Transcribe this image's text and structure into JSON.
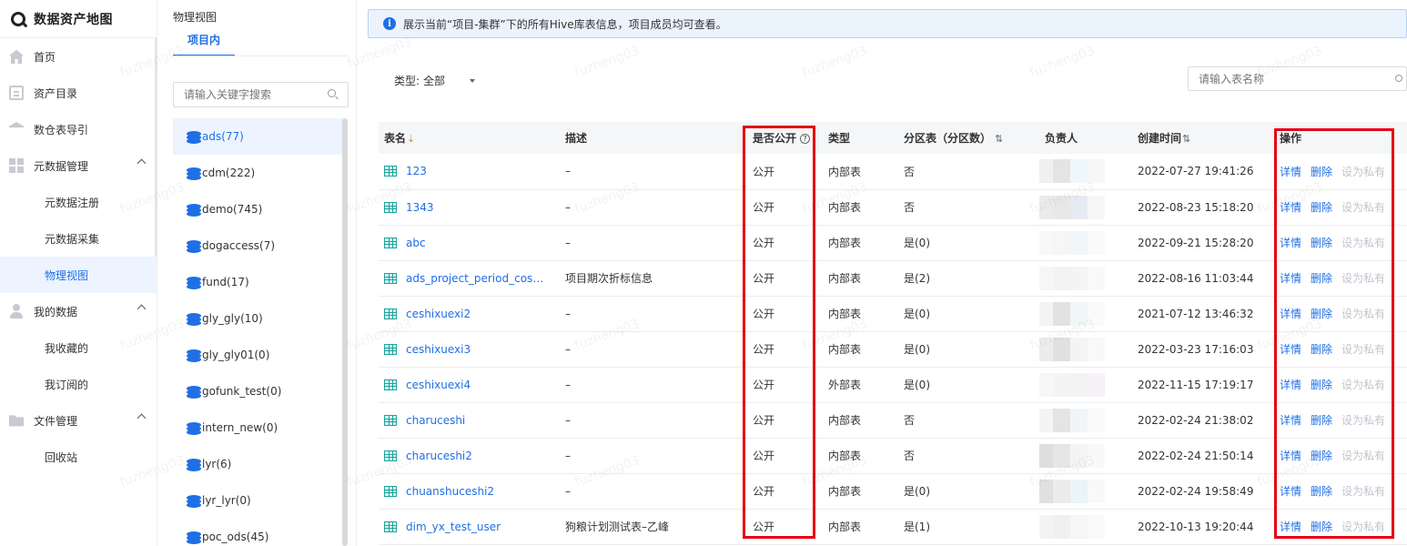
{
  "app": {
    "title": "数据资产地图"
  },
  "sidebar": {
    "items": [
      {
        "label": "首页"
      },
      {
        "label": "资产目录"
      },
      {
        "label": "数仓表导引"
      },
      {
        "label": "元数据管理"
      },
      {
        "label": "元数据注册"
      },
      {
        "label": "元数据采集"
      },
      {
        "label": "物理视图"
      },
      {
        "label": "我的数据"
      },
      {
        "label": "我收藏的"
      },
      {
        "label": "我订阅的"
      },
      {
        "label": "文件管理"
      },
      {
        "label": "回收站"
      }
    ]
  },
  "panel2": {
    "title": "物理视图",
    "tab": "项目内",
    "search_placeholder": "请输入关键字搜索",
    "databases": [
      "ads(77)",
      "cdm(222)",
      "demo(745)",
      "dogaccess(7)",
      "fund(17)",
      "gly_gly(10)",
      "gly_gly01(0)",
      "gofunk_test(0)",
      "intern_new(0)",
      "lyr(6)",
      "lyr_lyr(0)",
      "poc_ods(45)"
    ]
  },
  "notice": {
    "icon": "info-icon",
    "text": "展示当前“项目-集群”下的所有Hive库表信息，项目成员均可查看。"
  },
  "filter": {
    "label": "类型:",
    "value": "全部"
  },
  "table_search": {
    "placeholder": "请输入表名称"
  },
  "table": {
    "headers": {
      "name": "表名",
      "desc": "描述",
      "public": "是否公开",
      "type": "类型",
      "partition": "分区表（分区数）",
      "owner": "负责人",
      "created": "创建时间",
      "ops": "操作"
    },
    "sort_icon": "⇣",
    "question_mark": "?",
    "actions": {
      "detail": "详情",
      "delete": "删除",
      "set_private": "设为私有"
    },
    "rows": [
      {
        "name": "123",
        "desc": "–",
        "public": "公开",
        "type": "内部表",
        "partition": "否",
        "created": "2022-07-27 19:41:26"
      },
      {
        "name": "1343",
        "desc": "–",
        "public": "公开",
        "type": "内部表",
        "partition": "否",
        "created": "2022-08-23 15:18:20"
      },
      {
        "name": "abc",
        "desc": "–",
        "public": "公开",
        "type": "内部表",
        "partition": "是(0)",
        "created": "2022-09-21 15:28:20"
      },
      {
        "name": "ads_project_period_cos…",
        "desc": "项目期次折标信息",
        "public": "公开",
        "type": "内部表",
        "partition": "是(2)",
        "created": "2022-08-16 11:03:44"
      },
      {
        "name": "ceshixuexi2",
        "desc": "–",
        "public": "公开",
        "type": "内部表",
        "partition": "是(0)",
        "created": "2021-07-12 13:46:32"
      },
      {
        "name": "ceshixuexi3",
        "desc": "–",
        "public": "公开",
        "type": "内部表",
        "partition": "是(0)",
        "created": "2022-03-23 17:16:03"
      },
      {
        "name": "ceshixuexi4",
        "desc": "–",
        "public": "公开",
        "type": "外部表",
        "partition": "是(0)",
        "created": "2022-11-15 17:19:17"
      },
      {
        "name": "charuceshi",
        "desc": "–",
        "public": "公开",
        "type": "内部表",
        "partition": "否",
        "created": "2022-02-24 21:38:02"
      },
      {
        "name": "charuceshi2",
        "desc": "–",
        "public": "公开",
        "type": "内部表",
        "partition": "否",
        "created": "2022-02-24 21:50:14"
      },
      {
        "name": "chuanshuceshi2",
        "desc": "–",
        "public": "公开",
        "type": "内部表",
        "partition": "是(0)",
        "created": "2022-02-24 19:58:49"
      },
      {
        "name": "dim_yx_test_user",
        "desc": "狗粮计划测试表–乙峰",
        "public": "公开",
        "type": "内部表",
        "partition": "是(1)",
        "created": "2022-10-13 19:20:44"
      }
    ]
  },
  "watermark": "fuzheng03",
  "colors": {
    "accent": "#1f6fe5",
    "highlight": "#e60012",
    "table_icon": "#1fa39d"
  }
}
